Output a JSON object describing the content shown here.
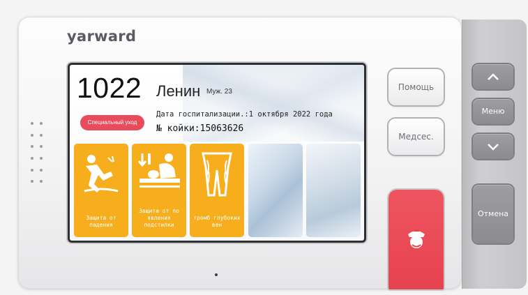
{
  "device": {
    "brand": "yarward"
  },
  "patient": {
    "room": "1022",
    "name": "Ленин",
    "sex_age": "Муж. 23",
    "special_care_badge": "Специальный уход",
    "admission": "Дата госпитализации.:1 октября 2022 года",
    "bed": "№ койки:15063626"
  },
  "care_tiles": [
    {
      "label": "Защита от падения",
      "icon": "fall-icon"
    },
    {
      "label": "Защита от по явления подстилки",
      "icon": "bedsore-icon"
    },
    {
      "label": "тромб глубоких вен",
      "icon": "dvt-icon"
    }
  ],
  "buttons": {
    "help": "Помощь",
    "nurse": "Медсес.",
    "menu": "Меню",
    "cancel": "Отмена",
    "up_icon": "chevron-up-icon",
    "down_icon": "chevron-down-icon",
    "call_icon": "nurse-call-icon"
  },
  "colors": {
    "tile_yellow": "#f6ae1c",
    "badge_red": "#e84b5a",
    "call_red": "#e6424f"
  }
}
